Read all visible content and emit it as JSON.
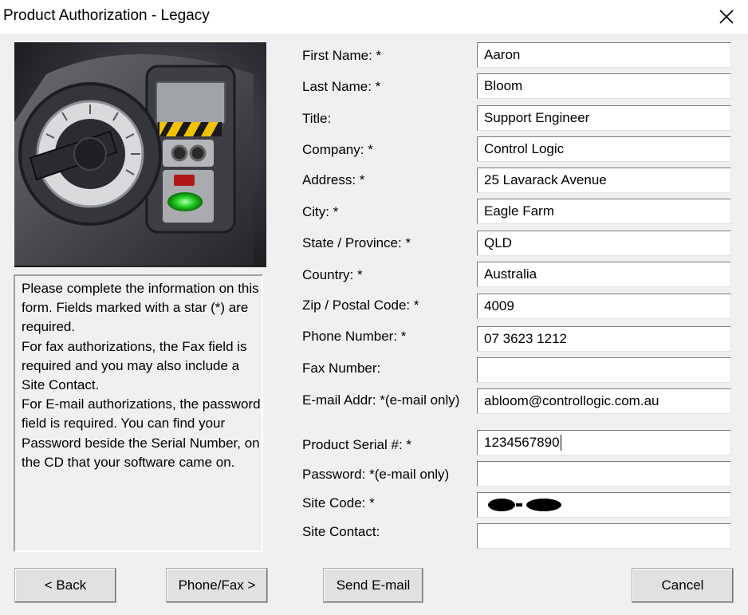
{
  "window": {
    "title": "Product Authorization - Legacy"
  },
  "instructions": "Please complete the information on this form.  Fields marked with a star (*) are required.\nFor fax authorizations, the Fax field is required and you may also include a Site Contact.\nFor E-mail authorizations, the password field is required.  You can find your Password beside the Serial Number, on the CD that your software came on.",
  "form": {
    "first_name": {
      "label": "First Name: *",
      "value": "Aaron"
    },
    "last_name": {
      "label": "Last Name: *",
      "value": "Bloom"
    },
    "title": {
      "label": "Title:",
      "value": "Support Engineer"
    },
    "company": {
      "label": "Company: *",
      "value": "Control Logic"
    },
    "address": {
      "label": "Address: *",
      "value": "25 Lavarack Avenue"
    },
    "city": {
      "label": "City: *",
      "value": "Eagle Farm"
    },
    "state": {
      "label": "State / Province: *",
      "value": "QLD"
    },
    "country": {
      "label": "Country: *",
      "value": "Australia"
    },
    "zip": {
      "label": "Zip / Postal Code: *",
      "value": "4009"
    },
    "phone": {
      "label": "Phone Number: *",
      "value": "07 3623 1212"
    },
    "fax": {
      "label": "Fax Number:",
      "value": ""
    },
    "email": {
      "label": "E-mail Addr: *(e-mail only)",
      "value": "abloom@controllogic.com.au"
    },
    "serial": {
      "label": "Product Serial #: *",
      "value": "1234567890"
    },
    "password": {
      "label": "Password: *(e-mail only)",
      "value": ""
    },
    "site_code": {
      "label": "Site Code: *",
      "value": ""
    },
    "site_contact": {
      "label": "Site Contact:",
      "value": ""
    }
  },
  "buttons": {
    "back": "< Back",
    "phone_fax": "Phone/Fax >",
    "send_email": "Send E-mail",
    "cancel": "Cancel"
  }
}
